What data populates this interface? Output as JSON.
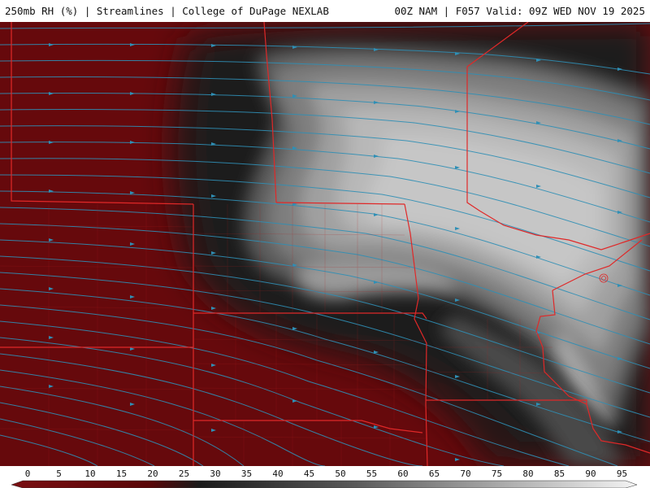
{
  "header": {
    "left_title": "250mb RH (%) | Streamlines | College of DuPage NEXLAB",
    "right_title": "00Z NAM | F057 Valid: 09Z WED NOV 19 2025"
  },
  "legend": {
    "ticks": [
      "0",
      "5",
      "10",
      "15",
      "20",
      "25",
      "30",
      "35",
      "40",
      "45",
      "50",
      "55",
      "60",
      "65",
      "70",
      "75",
      "80",
      "85",
      "90",
      "95"
    ]
  },
  "colors": {
    "dry": "#6a0a0d",
    "mid": "#1a1a1a",
    "moist": "#bdbdbd",
    "streamline": "#2f8fb5",
    "border": "#e02828"
  }
}
